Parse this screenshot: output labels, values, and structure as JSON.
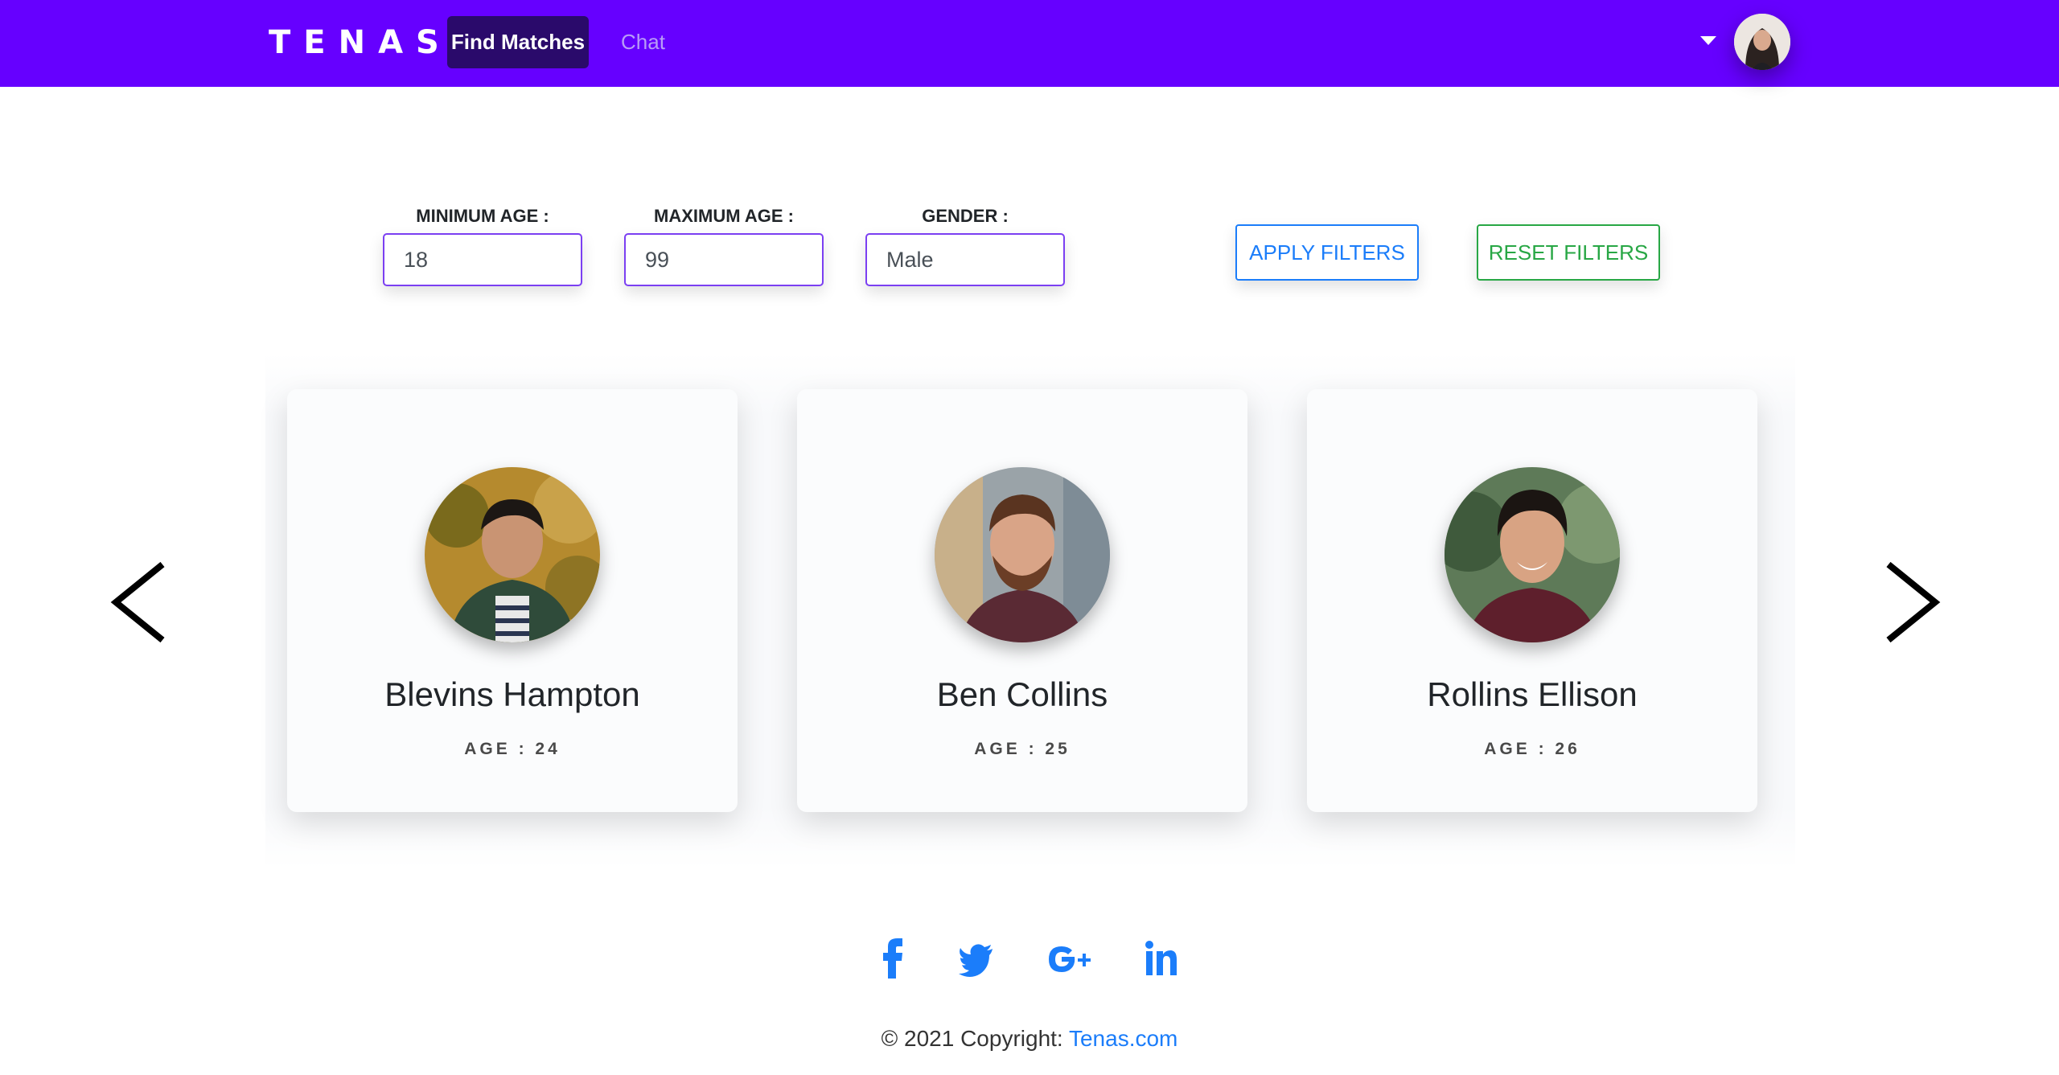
{
  "navbar": {
    "brand": "TENAS",
    "links": [
      {
        "label": "Find Matches",
        "active": true
      },
      {
        "label": "Chat",
        "active": false
      }
    ],
    "user_menu_icon": "caret-down-icon",
    "avatar_icon": "user-avatar"
  },
  "filters": {
    "min_age_label": "MINIMUM AGE :",
    "min_age_value": "18",
    "max_age_label": "MAXIMUM AGE :",
    "max_age_value": "99",
    "gender_label": "GENDER :",
    "gender_value": "Male",
    "apply_label": "APPLY FILTERS",
    "reset_label": "RESET FILTERS"
  },
  "carousel": {
    "prev_icon": "chevron-left-icon",
    "next_icon": "chevron-right-icon",
    "cards": [
      {
        "name": "Blevins Hampton",
        "age_text": "AGE : 24"
      },
      {
        "name": "Ben Collins",
        "age_text": "AGE : 25"
      },
      {
        "name": "Rollins Ellison",
        "age_text": "AGE : 26"
      }
    ]
  },
  "social": [
    {
      "icon": "facebook-icon"
    },
    {
      "icon": "twitter-icon"
    },
    {
      "icon": "google-plus-icon"
    },
    {
      "icon": "linkedin-icon"
    }
  ],
  "footer": {
    "copyright": "© 2021 Copyright: ",
    "link_text": "Tenas.com"
  },
  "colors": {
    "navbar": "#6600ff",
    "nav_active": "#2a0a6b",
    "link_blue": "#1b7dfa",
    "reset_green": "#28a745"
  }
}
